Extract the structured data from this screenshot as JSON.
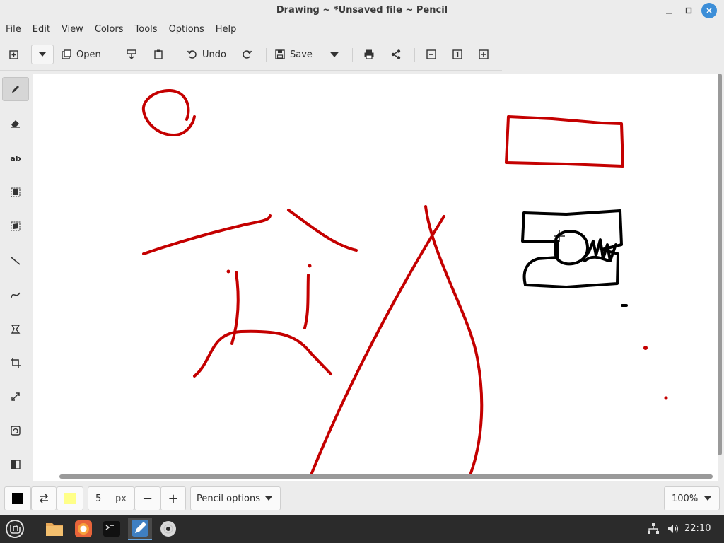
{
  "window": {
    "title": "Drawing ~ *Unsaved file ~ Pencil"
  },
  "menubar": {
    "items": [
      "File",
      "Edit",
      "View",
      "Colors",
      "Tools",
      "Options",
      "Help"
    ]
  },
  "toolbar": {
    "open_label": "Open",
    "undo_label": "Undo",
    "save_label": "Save"
  },
  "tools": {
    "text_tool_label": "ab"
  },
  "bottom": {
    "size_value": "5",
    "size_unit": "px",
    "minus": "−",
    "plus": "+",
    "options_label": "Pencil options",
    "zoom": "100%",
    "main_color": "#000000",
    "secondary_color": "#ffff88"
  },
  "taskbar": {
    "clock": "22:10"
  },
  "colors": {
    "stroke_red": "#c40000",
    "stroke_black": "#000000",
    "accent": "#3c8ed8"
  }
}
